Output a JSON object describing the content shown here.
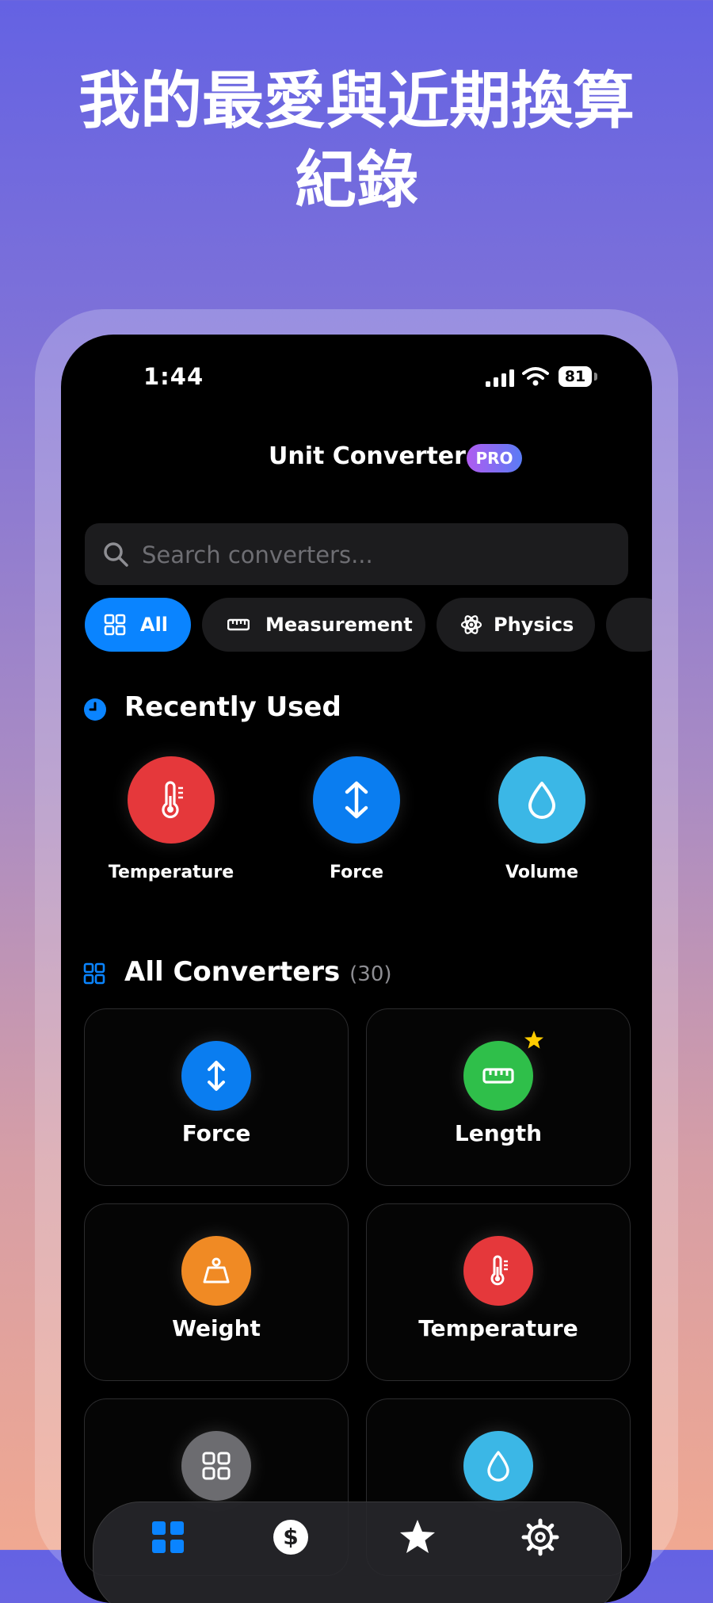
{
  "headline": {
    "line1": "我的最愛與近期換算",
    "line2": "紀錄"
  },
  "status_bar": {
    "time": "1:44",
    "battery": "81"
  },
  "app": {
    "title": "Unit Converter",
    "badge": "PRO"
  },
  "search": {
    "placeholder": "Search converters..."
  },
  "filters": [
    {
      "label": "All",
      "icon": "grid-icon",
      "active": true
    },
    {
      "label": "Measurement",
      "icon": "ruler-icon",
      "active": false
    },
    {
      "label": "Physics",
      "icon": "atom-icon",
      "active": false
    }
  ],
  "recent": {
    "title": "Recently Used",
    "items": [
      {
        "label": "Temperature",
        "icon": "thermometer-icon",
        "color": "#e5383b"
      },
      {
        "label": "Force",
        "icon": "arrows-vertical-icon",
        "color": "#0a7df0"
      },
      {
        "label": "Volume",
        "icon": "drop-icon",
        "color": "#3bb7e6"
      }
    ]
  },
  "converters": {
    "title": "All Converters",
    "count": "(30)",
    "items": [
      {
        "label": "Force",
        "icon": "arrows-vertical-icon",
        "color": "#0a7df0",
        "favorite": false
      },
      {
        "label": "Length",
        "icon": "ruler-icon",
        "color": "#2fbf4a",
        "favorite": true
      },
      {
        "label": "Weight",
        "icon": "weight-icon",
        "color": "#f08a24",
        "favorite": false
      },
      {
        "label": "Temperature",
        "icon": "thermometer-icon",
        "color": "#e5383b",
        "favorite": false
      },
      {
        "label": "",
        "icon": "grid-icon",
        "color": "#6c6c70",
        "favorite": false
      },
      {
        "label": "",
        "icon": "drop-icon",
        "color": "#3bb7e6",
        "favorite": false
      }
    ]
  },
  "tab_bar": [
    {
      "icon": "grid-icon",
      "active": true
    },
    {
      "icon": "dollar-icon",
      "active": false
    },
    {
      "icon": "star-icon",
      "active": false
    },
    {
      "icon": "gear-icon",
      "active": false
    }
  ],
  "colors": {
    "accent": "#0a84ff",
    "favorite_star": "#ffcc00"
  }
}
